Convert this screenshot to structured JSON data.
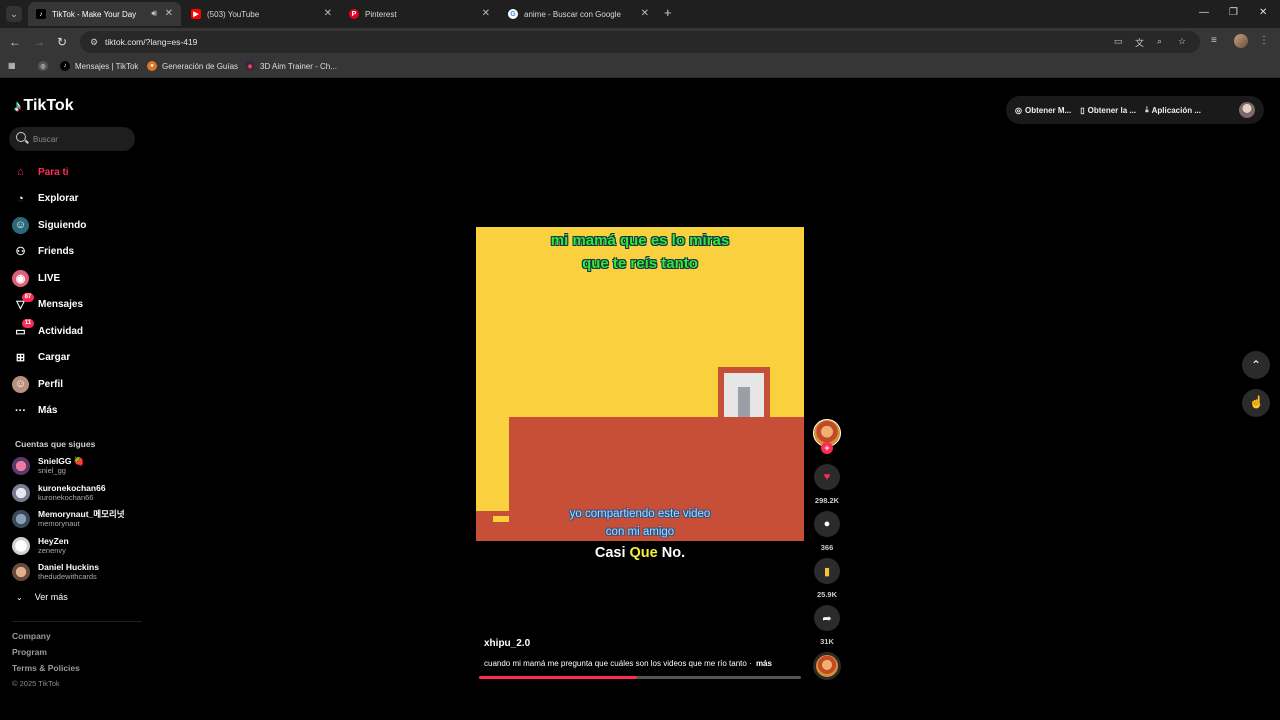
{
  "browser": {
    "tabs": [
      {
        "title": "TikTok - Make Your Day",
        "active": true
      },
      {
        "title": "(503) YouTube",
        "active": false
      },
      {
        "title": "Pinterest",
        "active": false
      },
      {
        "title": "anime - Buscar con Google",
        "active": false
      }
    ],
    "url": "tiktok.com/?lang=es-419",
    "bookmarks": [
      "Mensajes | TikTok",
      "Generación de Guías",
      "3D Aim Trainer - Ch..."
    ]
  },
  "tiktok": {
    "logo": "TikTok",
    "search_placeholder": "Buscar",
    "nav": [
      {
        "label": "Para ti",
        "active": true,
        "icon": "home-icon"
      },
      {
        "label": "Explorar",
        "active": false,
        "icon": "compass-icon"
      },
      {
        "label": "Siguiendo",
        "active": false,
        "icon": "following-icon"
      },
      {
        "label": "Friends",
        "active": false,
        "icon": "friends-icon"
      },
      {
        "label": "LIVE",
        "active": false,
        "icon": "live-icon"
      },
      {
        "label": "Mensajes",
        "active": false,
        "icon": "messages-icon",
        "badge": "87"
      },
      {
        "label": "Actividad",
        "active": false,
        "icon": "activity-icon",
        "badge": "11"
      },
      {
        "label": "Cargar",
        "active": false,
        "icon": "upload-icon"
      },
      {
        "label": "Perfil",
        "active": false,
        "icon": "profile-icon"
      },
      {
        "label": "Más",
        "active": false,
        "icon": "more-icon"
      }
    ],
    "following_title": "Cuentas que sigues",
    "following": [
      {
        "name": "SnielGG 🍓",
        "handle": "sniel_gg"
      },
      {
        "name": "kuronekochan66",
        "handle": "kuronekochan66"
      },
      {
        "name": "Memorynaut_메모리넛",
        "handle": "memorynaut"
      },
      {
        "name": "HeyZen",
        "handle": "zenenvy"
      },
      {
        "name": "Daniel Huckins",
        "handle": "thedudewithcards"
      }
    ],
    "see_more": "Ver más",
    "footer": {
      "links": [
        "Company",
        "Program",
        "Terms & Policies"
      ],
      "copyright": "© 2025 TikTok"
    },
    "top_buttons": [
      "Obtener M...",
      "Obtener la ...",
      "Aplicación ..."
    ]
  },
  "video": {
    "caption_top_line1": "mi mamá que es lo miras",
    "caption_top_line2": "que te reís tanto",
    "caption_bottom_line1": "yo compartiendo este video",
    "caption_bottom_line2": "con mi amigo",
    "subtitle_a": "Casi ",
    "subtitle_b": "Que",
    "subtitle_c": " No.",
    "author": "xhipu_2.0",
    "description": "cuando mi mamá me pregunta que cuáles son los videos que me río tanto ·",
    "more_label": "más",
    "progress": 0.49,
    "likes": "298.2K",
    "comments": "366",
    "saves": "25.9K",
    "shares": "31K"
  },
  "colors": {
    "accent": "#fe2c55",
    "video_bg": "#f9d03e",
    "ground": "#c84f37"
  }
}
